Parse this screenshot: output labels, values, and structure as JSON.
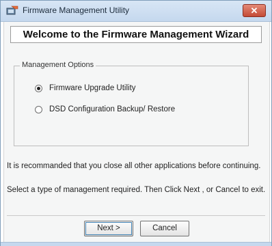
{
  "window": {
    "title": "Firmware Management Utility",
    "close_label": "✕"
  },
  "header": {
    "title": "Welcome to the Firmware Management Wizard"
  },
  "options": {
    "group_title": "Management Options",
    "items": [
      {
        "label": "Firmware Upgrade Utility",
        "selected": true
      },
      {
        "label": "DSD Configuration Backup/ Restore",
        "selected": false
      }
    ]
  },
  "info": {
    "line1": "It is recommanded that you close all other applications before continuing.",
    "line2": "Select a type of management required. Then Click Next , or Cancel to exit."
  },
  "buttons": {
    "next": "Next >",
    "cancel": "Cancel"
  }
}
